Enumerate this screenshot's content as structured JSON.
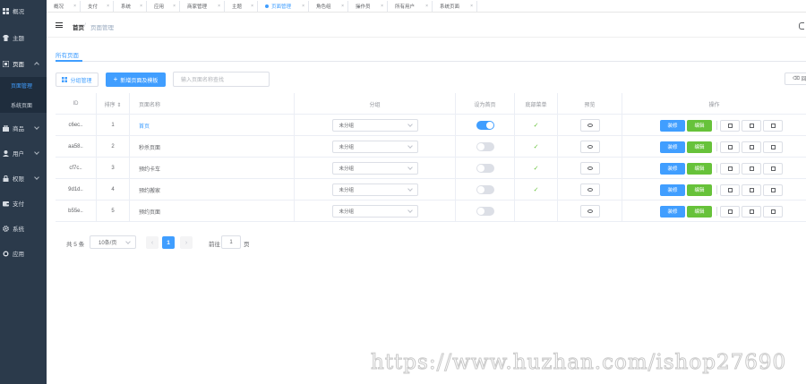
{
  "sidebar": {
    "items": [
      {
        "label": "概况",
        "icon": "dashboard-icon"
      },
      {
        "label": "主题",
        "icon": "shirt-icon"
      },
      {
        "label": "页面",
        "icon": "page-icon"
      },
      {
        "label": "商品",
        "icon": "goods-icon"
      },
      {
        "label": "用户",
        "icon": "user-icon"
      },
      {
        "label": "权限",
        "icon": "lock-icon"
      },
      {
        "label": "支付",
        "icon": "wallet-icon"
      },
      {
        "label": "系统",
        "icon": "gear-icon"
      },
      {
        "label": "应用",
        "icon": "app-icon"
      }
    ],
    "submenu": [
      {
        "label": "页面管理",
        "active": true
      },
      {
        "label": "系统页面",
        "active": false
      }
    ]
  },
  "tags": [
    {
      "label": "概况",
      "active": false
    },
    {
      "label": "支付",
      "active": false
    },
    {
      "label": "系统",
      "active": false
    },
    {
      "label": "应用",
      "active": false
    },
    {
      "label": "商家管理",
      "active": false
    },
    {
      "label": "主题",
      "active": false
    },
    {
      "label": "页面管理",
      "active": true
    },
    {
      "label": "角色组",
      "active": false
    },
    {
      "label": "操作员",
      "active": false
    },
    {
      "label": "所有用户",
      "active": false
    },
    {
      "label": "系统页面",
      "active": false
    }
  ],
  "header": {
    "breadcrumb_home": "首页",
    "breadcrumb_sep": "/",
    "breadcrumb_current": "页面管理"
  },
  "tab": {
    "label": "所有页面"
  },
  "toolbar": {
    "group_btn": "分组管理",
    "add_btn": "新增页面及模板",
    "search_placeholder": "输入页面名称查找",
    "right_btn": "回"
  },
  "table": {
    "headers": {
      "id": "ID",
      "sort": "排序 ⇕",
      "name": "页面名称",
      "group": "分组",
      "home": "设为首页",
      "nav": "底部菜单",
      "preview": "预览",
      "ops": "操作"
    },
    "rows": [
      {
        "id": "c6ec..",
        "sort": "1",
        "name": "首页",
        "group": "未分组",
        "home": true,
        "nav": "✓"
      },
      {
        "id": "aa58..",
        "sort": "2",
        "name": "秒杀页面",
        "group": "未分组",
        "home": false,
        "nav": "✓"
      },
      {
        "id": "cf7c..",
        "sort": "3",
        "name": "预约卡车",
        "group": "未分组",
        "home": false,
        "nav": "✓"
      },
      {
        "id": "9d1d..",
        "sort": "4",
        "name": "预约搬家",
        "group": "未分组",
        "home": false,
        "nav": "✓"
      },
      {
        "id": "b55e..",
        "sort": "5",
        "name": "预约页面",
        "group": "未分组",
        "home": false,
        "nav": ""
      }
    ],
    "op_design": "装修",
    "op_edit": "编辑"
  },
  "pagination": {
    "total": "共 5 条",
    "page_size": "10条/页",
    "prev": "‹",
    "current": "1",
    "next": "›",
    "goto_label": "前往",
    "goto_value": "1",
    "page_suffix": "页"
  },
  "watermark": "https://www.huzhan.com/ishop27690",
  "colors": {
    "sidebar_bg": "#2b3a4b",
    "primary": "#409eff",
    "success": "#67c23a"
  }
}
